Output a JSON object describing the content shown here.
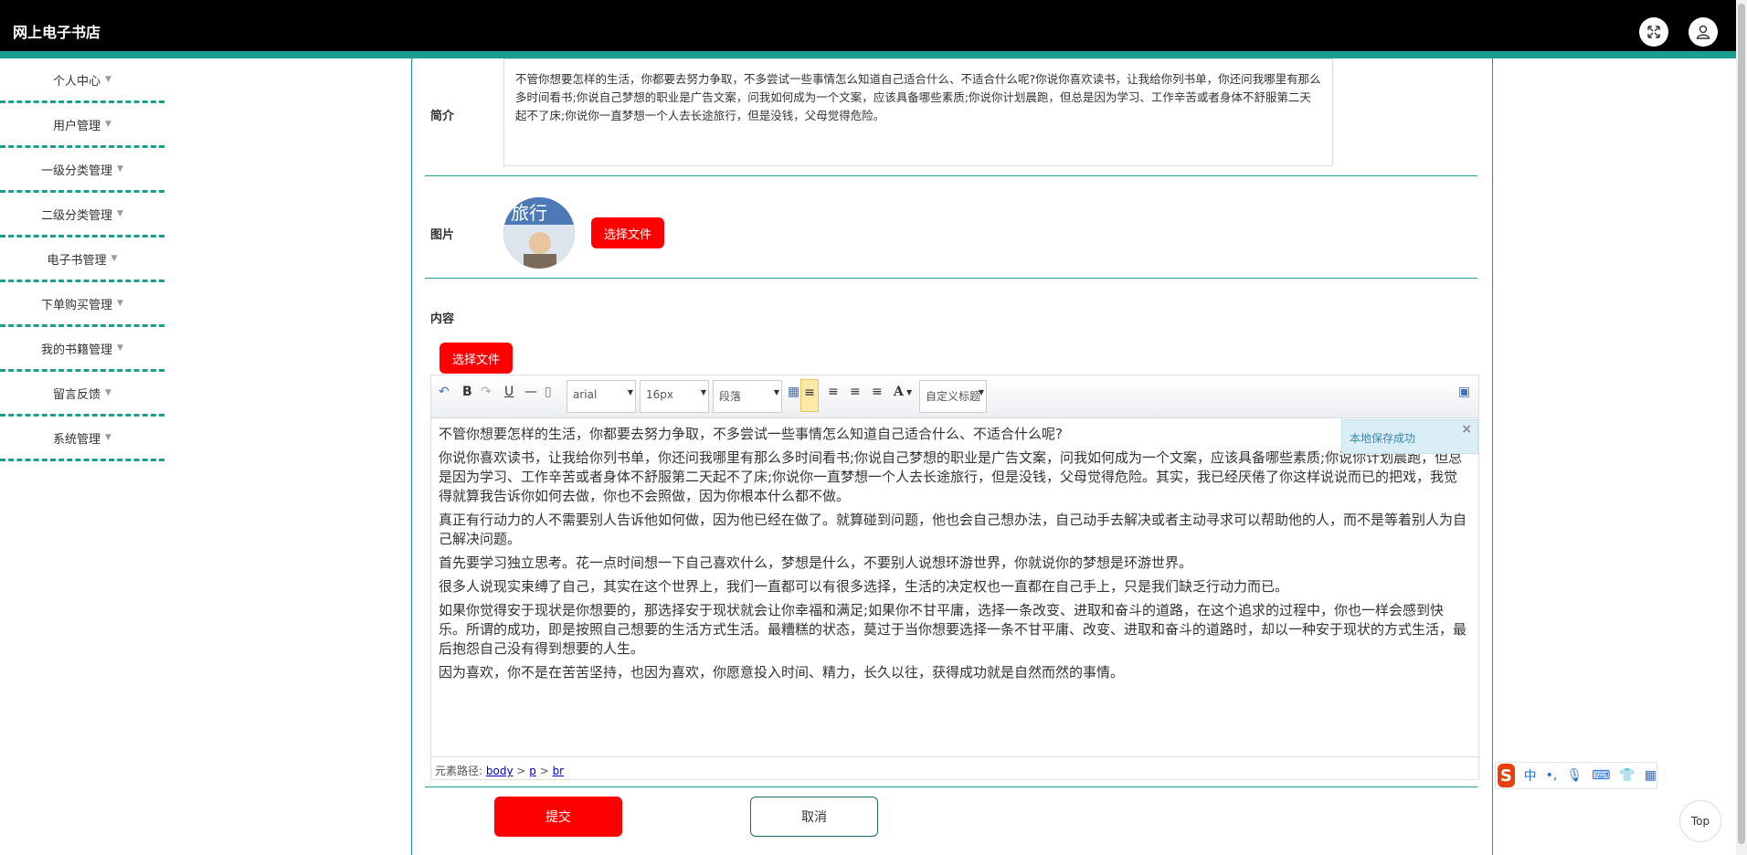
{
  "header": {
    "title": "网上电子书店"
  },
  "sidebar": {
    "items": [
      {
        "label": "个人中心"
      },
      {
        "label": "用户管理"
      },
      {
        "label": "一级分类管理"
      },
      {
        "label": "二级分类管理"
      },
      {
        "label": "电子书管理"
      },
      {
        "label": "下单购买管理"
      },
      {
        "label": "我的书籍管理"
      },
      {
        "label": "留言反馈"
      },
      {
        "label": "系统管理"
      }
    ]
  },
  "form": {
    "intro_label": "简介",
    "intro_text": "不管你想要怎样的生活，你都要去努力争取，不多尝试一些事情怎么知道自己适合什么、不适合什么呢?你说你喜欢读书，让我给你列书单，你还问我哪里有那么多时间看书;你说自己梦想的职业是广告文案，问我如何成为一个文案，应该具备哪些素质;你说你计划晨跑，但总是因为学习、工作辛苦或者身体不舒服第二天起不了床;你说你一直梦想一个人去长途旅行，但是没钱，父母觉得危险。",
    "image_label": "图片",
    "choose_file": "选择文件",
    "content_label": "内容",
    "content_choose_file": "选择文件",
    "submit": "提交",
    "cancel": "取消"
  },
  "editor": {
    "font": "arial",
    "size": "16px",
    "paragraph": "段落",
    "custom_title": "自定义标题",
    "toast": "本地保存成功",
    "paragraphs": [
      "不管你想要怎样的生活，你都要去努力争取，不多尝试一些事情怎么知道自己适合什么、不适合什么呢?",
      "你说你喜欢读书，让我给你列书单，你还问我哪里有那么多时间看书;你说自己梦想的职业是广告文案，问我如何成为一个文案，应该具备哪些素质;你说你计划晨跑，但总是因为学习、工作辛苦或者身体不舒服第二天起不了床;你说你一直梦想一个人去长途旅行，但是没钱，父母觉得危险。其实，我已经厌倦了你这样说说而已的把戏，我觉得就算我告诉你如何去做，你也不会照做，因为你根本什么都不做。",
      "真正有行动力的人不需要别人告诉他如何做，因为他已经在做了。就算碰到问题，他也会自己想办法，自己动手去解决或者主动寻求可以帮助他的人，而不是等着别人为自己解决问题。",
      "首先要学习独立思考。花一点时间想一下自己喜欢什么，梦想是什么，不要别人说想环游世界，你就说你的梦想是环游世界。",
      "很多人说现实束缚了自己，其实在这个世界上，我们一直都可以有很多选择，生活的决定权也一直都在自己手上，只是我们缺乏行动力而已。",
      "如果你觉得安于现状是你想要的，那选择安于现状就会让你幸福和满足;如果你不甘平庸，选择一条改变、进取和奋斗的道路，在这个追求的过程中，你也一样会感到快乐。所谓的成功，即是按照自己想要的生活方式生活。最糟糕的状态，莫过于当你想要选择一条不甘平庸、改变、进取和奋斗的道路时，却以一种安于现状的方式生活，最后抱怨自己没有得到想要的人生。",
      "因为喜欢，你不是在苦苦坚持，也因为喜欢，你愿意投入时间、精力，长久以往，获得成功就是自然而然的事情。"
    ],
    "path_label": "元素路径:",
    "path": [
      "body",
      "p",
      "br"
    ]
  },
  "misc": {
    "top": "Top",
    "ime_label": "中"
  }
}
